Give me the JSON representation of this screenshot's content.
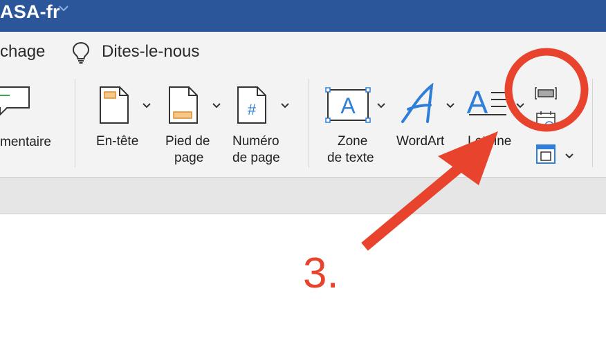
{
  "window": {
    "title_fragment": "ASA-fr",
    "title_chevron_icon": "chevron-down-icon",
    "titlebar_color": "#2b579a"
  },
  "tabs": {
    "partial_tab_label": "chage",
    "tell_me_icon": "lightbulb-icon",
    "tell_me_label": "Dites-le-nous"
  },
  "ribbon": {
    "comment": {
      "label": "mentaire",
      "icon": "comment-icon"
    },
    "header": {
      "line1": "En-tête",
      "icon": "header-icon"
    },
    "footer": {
      "line1": "Pied de",
      "line2": "page",
      "icon": "footer-icon"
    },
    "page_number": {
      "line1": "Numéro",
      "line2": "de page",
      "icon": "page-number-icon",
      "glyph": "#"
    },
    "text_box": {
      "line1": "Zone",
      "line2": "de texte",
      "icon": "text-box-icon",
      "glyph": "A"
    },
    "wordart": {
      "label": "WordArt",
      "icon": "wordart-icon",
      "glyph": "A"
    },
    "drop_cap": {
      "label": "Lettrine",
      "icon": "drop-cap-icon",
      "glyph": "A"
    },
    "small_buttons": [
      "field-icon",
      "date-time-icon",
      "object-icon"
    ]
  },
  "annotation": {
    "step_label": "3.",
    "color": "#e8432d"
  }
}
